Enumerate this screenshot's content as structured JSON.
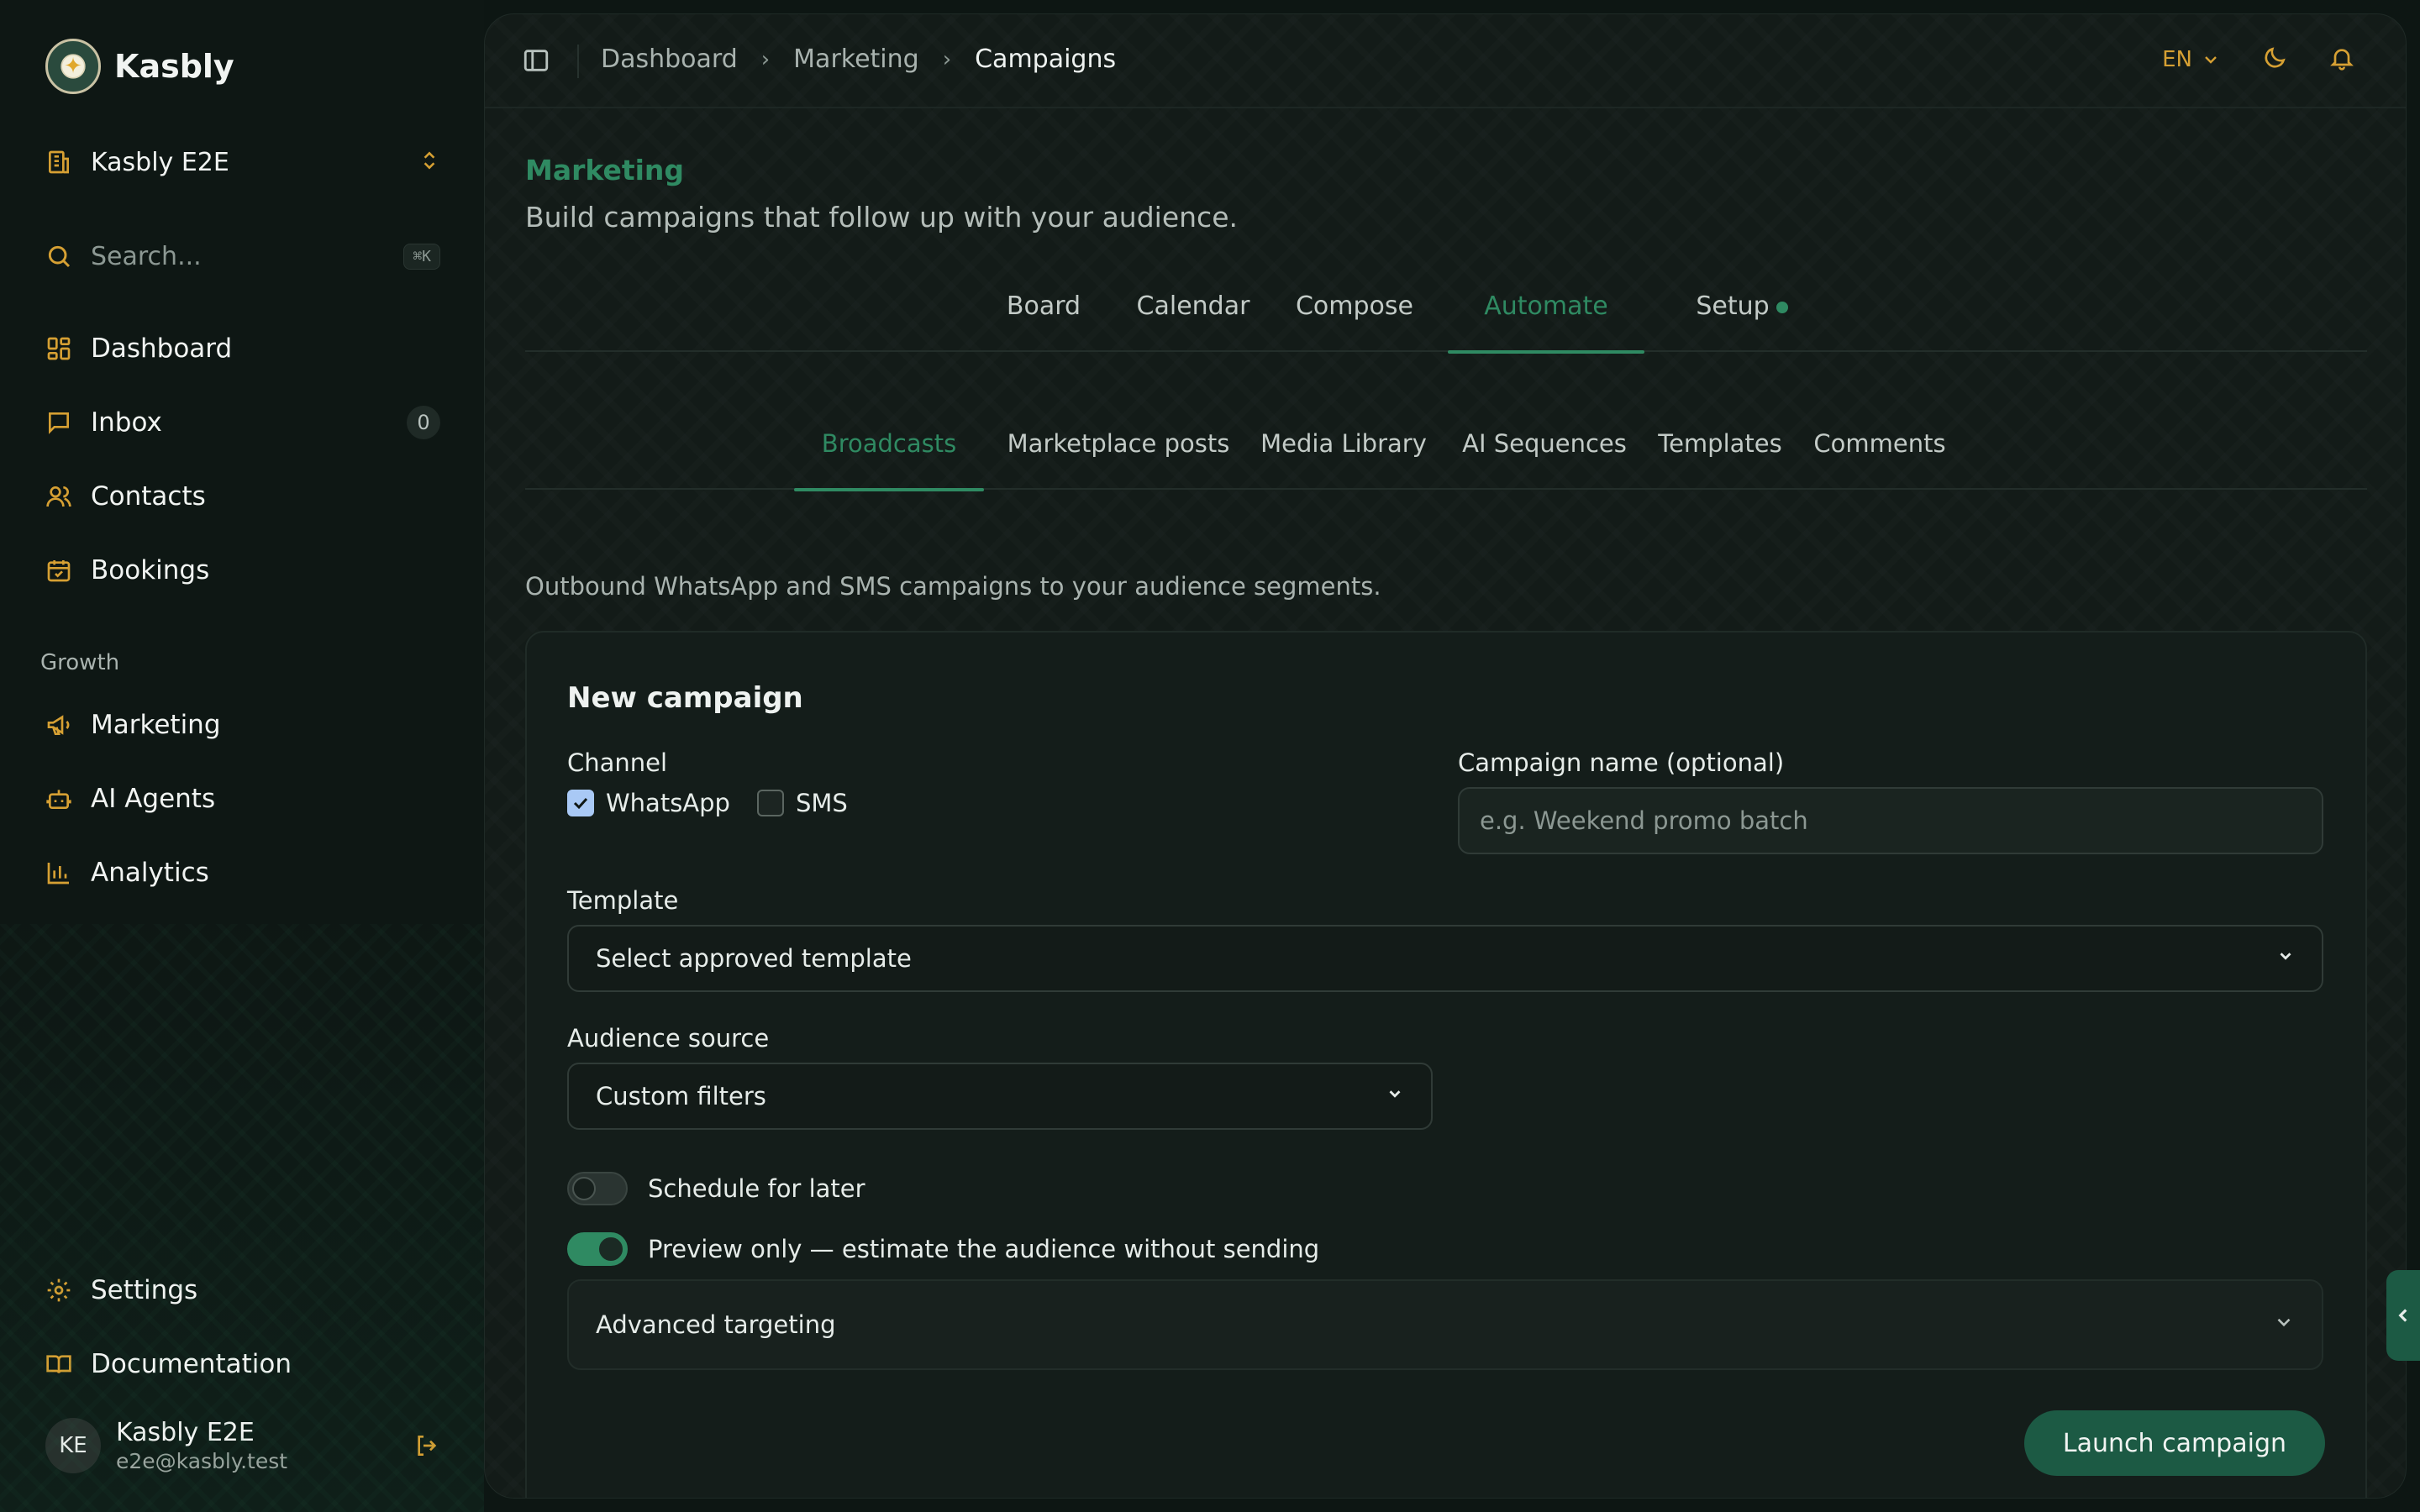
{
  "brand": {
    "name": "Kasbly"
  },
  "workspace": {
    "name": "Kasbly E2E"
  },
  "search": {
    "placeholder": "Search...",
    "shortcut": "⌘K"
  },
  "sidebar": {
    "items": [
      {
        "label": "Dashboard",
        "icon": "dashboard-icon"
      },
      {
        "label": "Inbox",
        "icon": "inbox-icon",
        "badge": "0"
      },
      {
        "label": "Contacts",
        "icon": "users-icon"
      },
      {
        "label": "Bookings",
        "icon": "calendar-icon"
      }
    ],
    "section_label": "Growth",
    "growth_items": [
      {
        "label": "Marketing",
        "icon": "megaphone-icon"
      },
      {
        "label": "AI Agents",
        "icon": "bot-icon"
      },
      {
        "label": "Analytics",
        "icon": "bar-chart-icon"
      }
    ],
    "footer_items": [
      {
        "label": "Settings",
        "icon": "gear-icon"
      },
      {
        "label": "Documentation",
        "icon": "book-icon"
      }
    ]
  },
  "user": {
    "initials": "KE",
    "name": "Kasbly E2E",
    "email": "e2e@kasbly.test"
  },
  "breadcrumb": {
    "items": [
      "Dashboard",
      "Marketing",
      "Campaigns"
    ]
  },
  "topbar": {
    "language": "EN"
  },
  "page": {
    "eyebrow": "Marketing",
    "description": "Build campaigns that follow up with your audience."
  },
  "tabs_primary": [
    "Board",
    "Calendar",
    "Compose",
    "Automate",
    "Setup"
  ],
  "tabs_primary_active": "Automate",
  "tabs_secondary": [
    "Broadcasts",
    "Marketplace posts",
    "Media Library",
    "AI Sequences",
    "Templates",
    "Comments"
  ],
  "tabs_secondary_active": "Broadcasts",
  "section": {
    "description": "Outbound WhatsApp and SMS campaigns to your audience segments."
  },
  "form": {
    "title": "New campaign",
    "channel_label": "Channel",
    "channels": [
      {
        "label": "WhatsApp",
        "checked": true
      },
      {
        "label": "SMS",
        "checked": false
      }
    ],
    "campaign_name_label": "Campaign name (optional)",
    "campaign_name_placeholder": "e.g. Weekend promo batch",
    "campaign_name_value": "",
    "template_label": "Template",
    "template_value": "Select approved template",
    "audience_label": "Audience source",
    "audience_value": "Custom filters",
    "schedule_label": "Schedule for later",
    "schedule_on": false,
    "preview_label": "Preview only — estimate the audience without sending",
    "preview_on": true,
    "advanced_label": "Advanced targeting",
    "launch_label": "Launch campaign"
  },
  "colors": {
    "accent": "#2f8a62",
    "icon_gold": "#d6a033",
    "launch_button": "#1c5a44"
  }
}
